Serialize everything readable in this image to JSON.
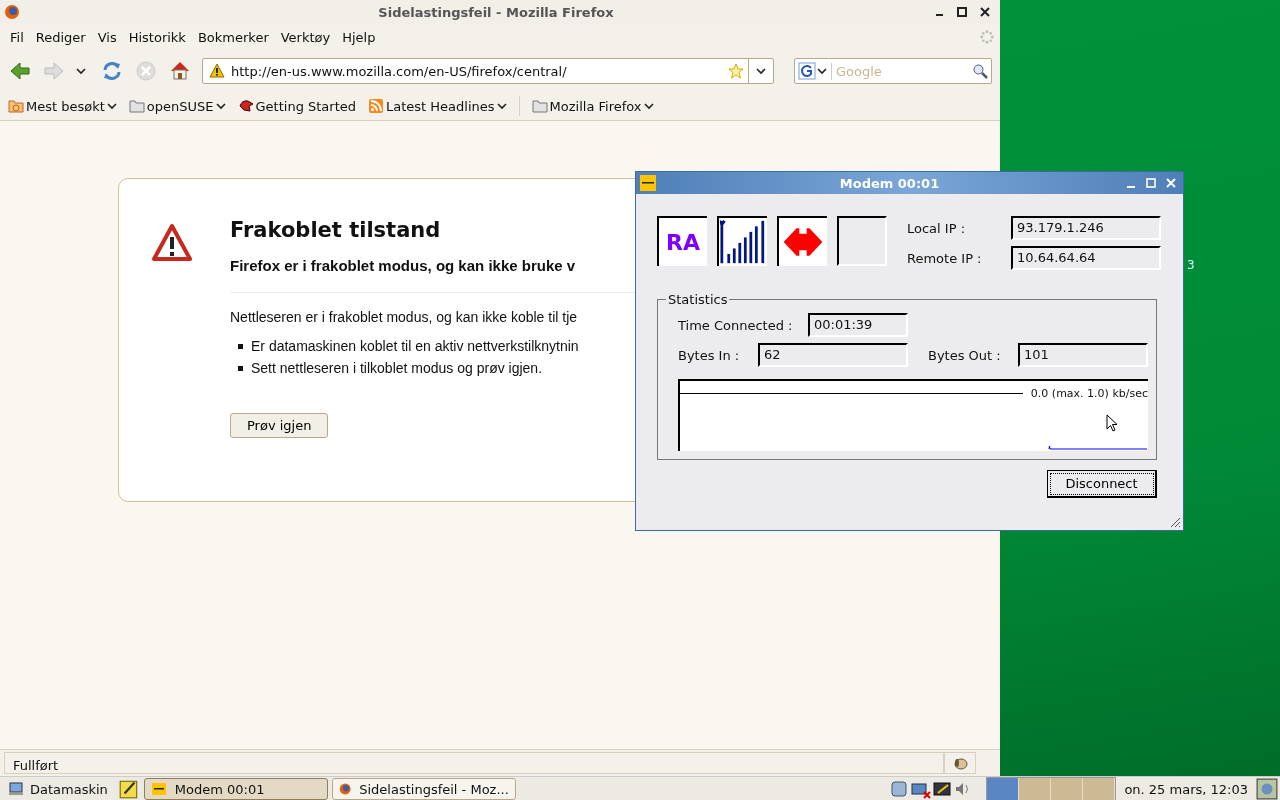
{
  "firefox": {
    "title": "Sidelastingsfeil - Mozilla Firefox",
    "menu": [
      "Fil",
      "Rediger",
      "Vis",
      "Historikk",
      "Bokmerker",
      "Verktøy",
      "Hjelp"
    ],
    "url": "http://en-us.www.mozilla.com/en-US/firefox/central/",
    "search_placeholder": "Google",
    "bookmarks": [
      {
        "label": "Mest besøkt",
        "kind": "feed-folder",
        "dropdown": true
      },
      {
        "label": "openSUSE",
        "kind": "folder",
        "dropdown": true
      },
      {
        "label": "Getting Started",
        "kind": "bird",
        "dropdown": false
      },
      {
        "label": "Latest Headlines",
        "kind": "feed",
        "dropdown": true
      },
      {
        "label": "Mozilla Firefox",
        "kind": "folder",
        "dropdown": true
      }
    ],
    "error": {
      "title": "Frakoblet tilstand",
      "subtitle": "Firefox er i frakoblet modus, og kan ikke bruke v",
      "text": "Nettleseren er i frakoblet modus, og kan ikke koble til tje",
      "bullets": [
        "Er datamaskinen koblet til en aktiv nettverkstilknytnin",
        "Sett nettleseren i tilkoblet modus og prøv igjen."
      ],
      "button": "Prøv igjen"
    },
    "status": "Fullført"
  },
  "modem": {
    "title": "Modem 00:01",
    "ra": "RA",
    "local_ip_label": "Local IP :",
    "local_ip": "93.179.1.246",
    "remote_ip_label": "Remote IP :",
    "remote_ip": "10.64.64.64",
    "statistics_label": "Statistics",
    "time_label": "Time Connected :",
    "time": "00:01:39",
    "bytes_in_label": "Bytes In :",
    "bytes_in": "62",
    "bytes_out_label": "Bytes Out :",
    "bytes_out": "101",
    "graph_label": "0.0 (max. 1.0) kb/sec",
    "button": "Disconnect"
  },
  "desktop_label": "3",
  "taskbar": {
    "start": "Datamaskin",
    "tasks": [
      {
        "label": "Modem 00:01",
        "kind": "modem",
        "selected": true
      },
      {
        "label": "Sidelastingsfeil - Moz...",
        "kind": "firefox",
        "selected": false
      }
    ],
    "workspaces": [
      {
        "selected": true
      },
      {
        "selected": false
      },
      {
        "selected": false
      },
      {
        "selected": false
      }
    ],
    "clock": "on. 25 mars, 12:03"
  }
}
